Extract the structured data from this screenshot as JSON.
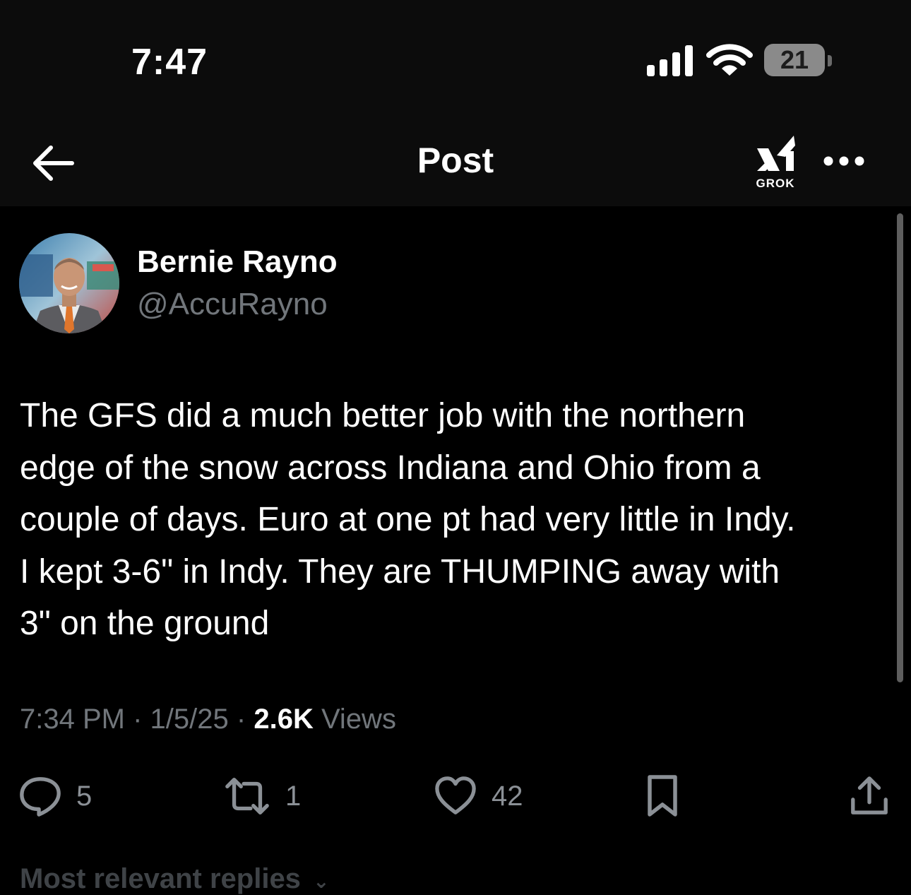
{
  "status_bar": {
    "time": "7:47",
    "battery_level": "21",
    "icons": [
      "signal-icon",
      "wifi-icon",
      "battery-icon"
    ]
  },
  "nav": {
    "title": "Post",
    "grok_label": "GROK",
    "icons": [
      "back-arrow-icon",
      "grok-icon",
      "more-icon"
    ]
  },
  "post": {
    "author_name": "Bernie Rayno",
    "author_handle": "@AccuRayno",
    "text": "The GFS did a much better job with the northern\nedge of the snow across Indiana and Ohio from a\ncouple of days. Euro at one pt had very little in Indy.\nI kept 3-6\" in Indy. They are THUMPING away with\n3\" on the ground",
    "time": "7:34 PM",
    "separator": "·",
    "date": "1/5/25",
    "views_count": "2.6K",
    "views_label": "Views"
  },
  "actions": {
    "replies": "5",
    "reposts": "1",
    "likes": "42",
    "icons": [
      "reply-icon",
      "repost-icon",
      "like-icon",
      "bookmark-icon",
      "share-icon"
    ]
  },
  "replies_section": {
    "label": "Most relevant replies",
    "icon": "chevron-down-icon"
  },
  "colors": {
    "background": "#000000",
    "bar_background": "#0c0c0c",
    "text_primary": "#ffffff",
    "text_secondary": "#71767b",
    "icon_gray": "#8b9096"
  }
}
